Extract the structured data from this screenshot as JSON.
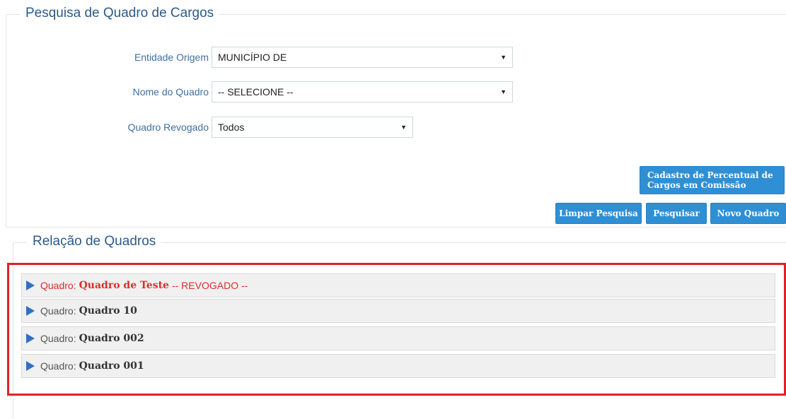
{
  "search_panel": {
    "legend": "Pesquisa de Quadro de Cargos",
    "fields": [
      {
        "label": "Entidade Origem",
        "value": "MUNICÍPIO DE"
      },
      {
        "label": "Nome do Quadro",
        "value": "-- SELECIONE --"
      },
      {
        "label": "Quadro Revogado",
        "value": "Todos"
      }
    ],
    "buttons": {
      "cadastro_line1": "Cadastro de Percentual de",
      "cadastro_line2": "Cargos em Comissão",
      "limpar": "Limpar Pesquisa",
      "pesquisar": "Pesquisar",
      "novo": "Novo Quadro"
    }
  },
  "results_panel": {
    "legend": "Relação de Quadros",
    "items": [
      {
        "prefix": "Quadro:",
        "name": "Quadro de Teste",
        "suffix": "-- REVOGADO --"
      },
      {
        "prefix": "Quadro:",
        "name": "Quadro 10",
        "suffix": ""
      },
      {
        "prefix": "Quadro:",
        "name": "Quadro 002",
        "suffix": ""
      },
      {
        "prefix": "Quadro:",
        "name": "Quadro 001",
        "suffix": ""
      }
    ]
  },
  "colors": {
    "accent": "#2f8fd4",
    "legend_text": "#2c5a8a",
    "revoked_text": "#e02b2b",
    "highlight_border": "#e02028"
  },
  "icons": {
    "dropdown": "caret-down-icon",
    "expand": "triangle-right-icon"
  }
}
